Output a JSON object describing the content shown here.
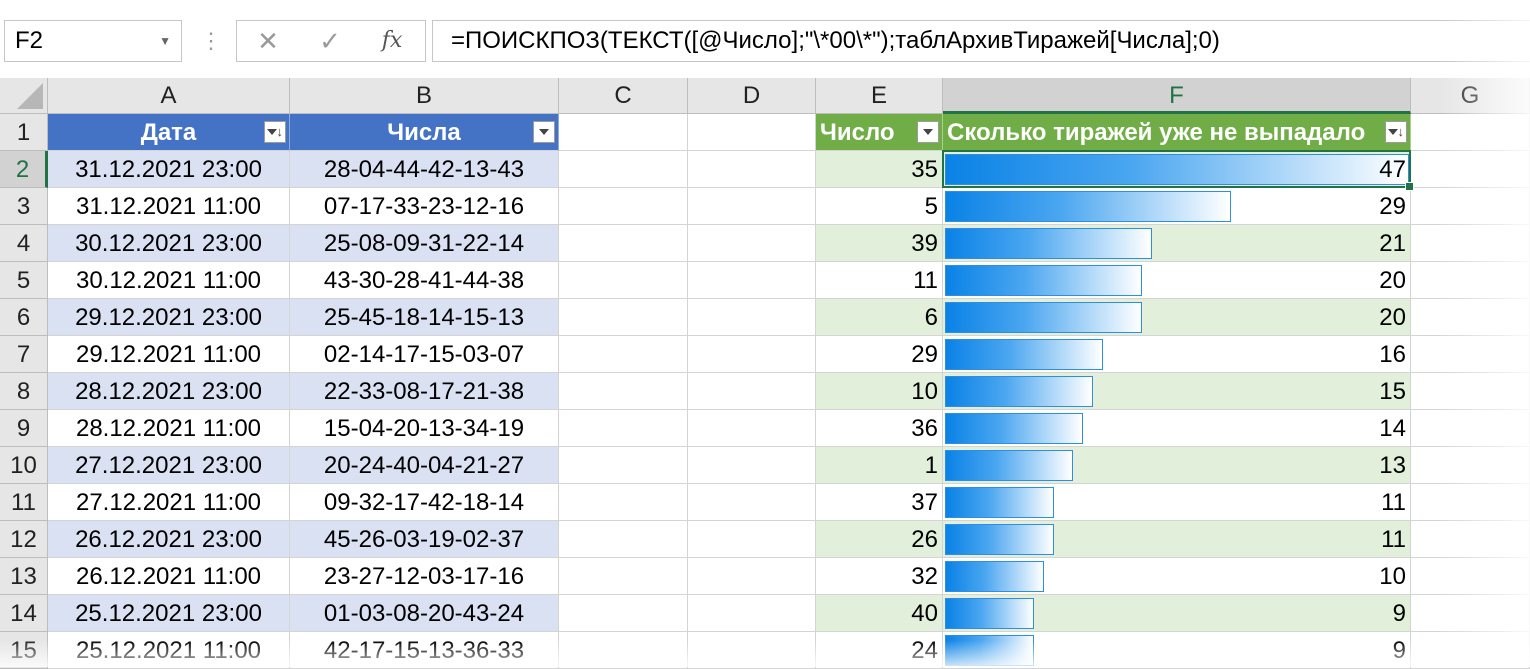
{
  "name_box": {
    "value": "F2"
  },
  "formula_bar": {
    "cancel_icon": "close-icon",
    "enter_icon": "check-icon",
    "fx_label": "fx",
    "formula": "=ПОИСКПОЗ(ТЕКСТ([@Число];\"\\*00\\*\");таблАрхивТиражей[Числа];0)"
  },
  "columns": [
    "A",
    "B",
    "C",
    "D",
    "E",
    "F",
    "G"
  ],
  "selected_column": "F",
  "selected_row": "2",
  "rows": [
    "1",
    "2",
    "3",
    "4",
    "5",
    "6",
    "7",
    "8",
    "9",
    "10",
    "11",
    "12",
    "13",
    "14",
    "15"
  ],
  "table_archive": {
    "headers": [
      "Дата",
      "Числа"
    ],
    "rows": [
      [
        "31.12.2021 23:00",
        "28-04-44-42-13-43"
      ],
      [
        "31.12.2021 11:00",
        "07-17-33-23-12-16"
      ],
      [
        "30.12.2021 23:00",
        "25-08-09-31-22-14"
      ],
      [
        "30.12.2021 11:00",
        "43-30-28-41-44-38"
      ],
      [
        "29.12.2021 23:00",
        "25-45-18-14-15-13"
      ],
      [
        "29.12.2021 11:00",
        "02-14-17-15-03-07"
      ],
      [
        "28.12.2021 23:00",
        "22-33-08-17-21-38"
      ],
      [
        "28.12.2021 11:00",
        "15-04-20-13-34-19"
      ],
      [
        "27.12.2021 23:00",
        "20-24-40-04-21-27"
      ],
      [
        "27.12.2021 11:00",
        "09-32-17-42-18-14"
      ],
      [
        "26.12.2021 23:00",
        "45-26-03-19-02-37"
      ],
      [
        "26.12.2021 11:00",
        "23-27-12-03-17-16"
      ],
      [
        "25.12.2021 23:00",
        "01-03-08-20-43-24"
      ],
      [
        "25.12.2021 11:00",
        "42-17-15-13-36-33"
      ]
    ]
  },
  "table_stats": {
    "headers": [
      "Число",
      "Сколько тиражей уже не выпадало"
    ],
    "bar_max": 47,
    "rows": [
      [
        "35",
        "47"
      ],
      [
        "5",
        "29"
      ],
      [
        "39",
        "21"
      ],
      [
        "11",
        "20"
      ],
      [
        "6",
        "20"
      ],
      [
        "29",
        "16"
      ],
      [
        "10",
        "15"
      ],
      [
        "36",
        "14"
      ],
      [
        "1",
        "13"
      ],
      [
        "37",
        "11"
      ],
      [
        "26",
        "11"
      ],
      [
        "32",
        "10"
      ],
      [
        "40",
        "9"
      ],
      [
        "24",
        "9"
      ]
    ]
  },
  "colors": {
    "table_blue": "#4472c4",
    "table_green": "#70ad47",
    "bar_blue": "#0a82e6",
    "selection": "#217346"
  }
}
